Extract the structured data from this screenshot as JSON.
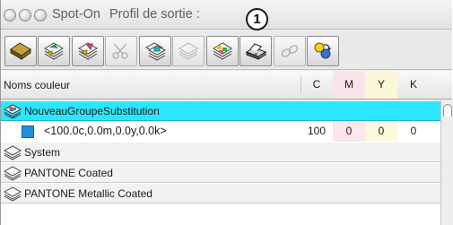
{
  "window": {
    "title": "Spot-On",
    "subtitle": "Profil de sortie :",
    "callout": "1"
  },
  "toolbar": {
    "buttons": [
      {
        "icon": "open-folder-diamond-icon",
        "enabled": true
      },
      {
        "icon": "import-swatches-icon",
        "enabled": true
      },
      {
        "icon": "export-swatches-icon",
        "enabled": true
      },
      {
        "icon": "scissors-icon",
        "enabled": false
      },
      {
        "icon": "copy-swatches-icon",
        "enabled": true
      },
      {
        "icon": "paste-swatches-icon",
        "enabled": false
      },
      {
        "icon": "edit-swatches-icon",
        "enabled": true
      },
      {
        "icon": "print-icon",
        "enabled": true
      },
      {
        "icon": "link-icon",
        "enabled": false
      },
      {
        "icon": "substitution-icon",
        "enabled": true
      }
    ]
  },
  "columns": {
    "names": "Noms couleur",
    "c": "C",
    "m": "M",
    "y": "Y",
    "k": "K"
  },
  "rows": [
    {
      "type": "group",
      "label": "NouveauGroupeSubstitution",
      "selected": true,
      "icon": "substitution-group-icon"
    },
    {
      "type": "color",
      "label": "<100.0c,0.0m,0.0y,0.0k>",
      "c": "100",
      "m": "0",
      "y": "0",
      "k": "0",
      "swatch": "#1f8fe0"
    },
    {
      "type": "group",
      "label": "System",
      "icon": "swatch-book-icon"
    },
    {
      "type": "group",
      "label": "PANTONE Coated",
      "icon": "swatch-book-icon"
    },
    {
      "type": "group",
      "label": "PANTONE Metallic Coated",
      "icon": "swatch-book-icon"
    }
  ]
}
